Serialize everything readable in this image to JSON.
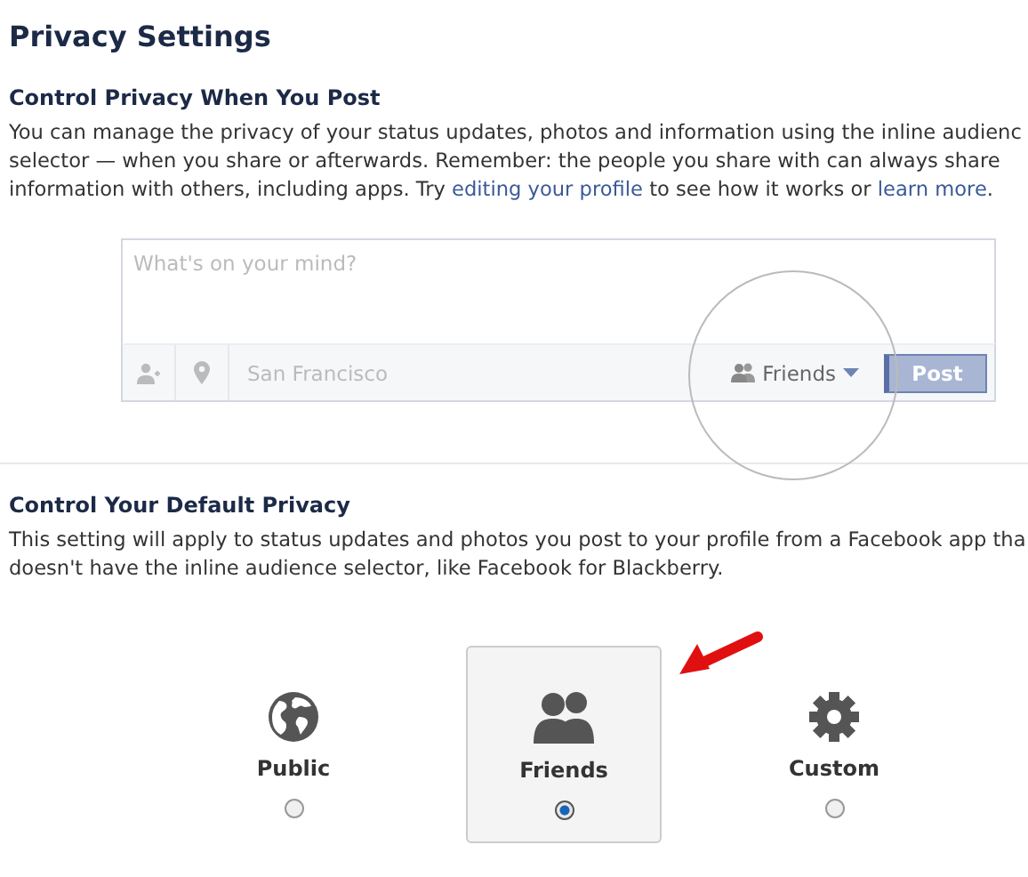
{
  "title": "Privacy Settings",
  "post_section": {
    "heading": "Control Privacy When You Post",
    "paragraph": [
      {
        "kind": "text",
        "text": "You can manage the privacy of your status updates, photos and information using the inline audienc"
      },
      {
        "kind": "break"
      },
      {
        "kind": "text",
        "text": "selector — when you share or afterwards. Remember: the people you share with can always share"
      },
      {
        "kind": "break"
      },
      {
        "kind": "text",
        "text": "information with others, including apps. Try "
      },
      {
        "kind": "link",
        "text": "editing your profile"
      },
      {
        "kind": "text",
        "text": " to see how it works or "
      },
      {
        "kind": "link",
        "text": "learn more"
      },
      {
        "kind": "text",
        "text": "."
      }
    ],
    "composer": {
      "placeholder": "What's on your mind?",
      "location": "San Francisco",
      "audience": "Friends",
      "post_button": "Post"
    }
  },
  "default_section": {
    "heading": "Control Your Default Privacy",
    "paragraph": [
      {
        "kind": "text",
        "text": "This setting will apply to status updates and photos you post to your profile from a Facebook app tha"
      },
      {
        "kind": "break"
      },
      {
        "kind": "text",
        "text": "doesn't have the inline audience selector, like Facebook for Blackberry."
      }
    ],
    "options": [
      {
        "kind": "globe",
        "label": "Public",
        "selected": false
      },
      {
        "kind": "people",
        "label": "Friends",
        "selected": true
      },
      {
        "kind": "gear",
        "label": "Custom",
        "selected": false
      }
    ]
  }
}
